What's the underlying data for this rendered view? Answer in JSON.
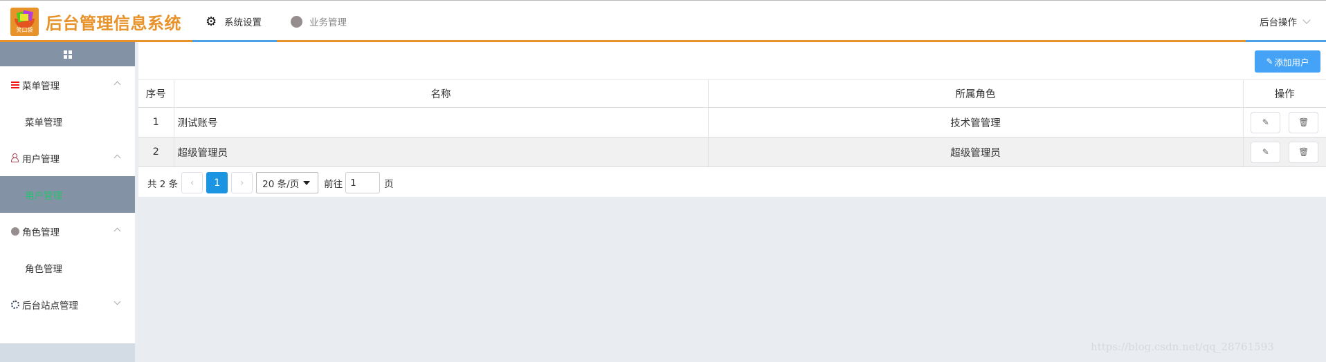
{
  "header": {
    "logo_text": "笑口袋",
    "app_title": "后台管理信息系统",
    "tabs": [
      {
        "label": "系统设置",
        "icon": "gear-icon",
        "active": true
      },
      {
        "label": "业务管理",
        "icon": "circle-icon",
        "active": false
      }
    ],
    "ops_label": "后台操作"
  },
  "sidebar": {
    "groups": [
      {
        "label": "菜单管理",
        "icon": "menu-lines-icon",
        "expanded": true,
        "items": [
          {
            "label": "菜单管理",
            "active": false
          }
        ]
      },
      {
        "label": "用户管理",
        "icon": "user-icon",
        "expanded": true,
        "items": [
          {
            "label": "用户管理",
            "active": true
          }
        ]
      },
      {
        "label": "角色管理",
        "icon": "role-dot-icon",
        "expanded": true,
        "items": [
          {
            "label": "角色管理",
            "active": false
          }
        ]
      },
      {
        "label": "后台站点管理",
        "icon": "site-gear-icon",
        "expanded": false,
        "items": []
      }
    ]
  },
  "toolbar": {
    "add_user_label": "添加用户"
  },
  "table": {
    "columns": [
      "序号",
      "名称",
      "所属角色",
      "操作"
    ],
    "rows": [
      {
        "index": "1",
        "name": "测试账号",
        "role": "技术管管理"
      },
      {
        "index": "2",
        "name": "超级管理员",
        "role": "超级管理员"
      }
    ],
    "row_actions": [
      "edit-icon",
      "delete-icon"
    ]
  },
  "pagination": {
    "total_text": "共 2 条",
    "prev": "‹",
    "current_page": "1",
    "next": "›",
    "page_size": "20 条/页",
    "goto_label": "前往",
    "goto_value": "1",
    "page_unit": "页"
  },
  "watermark": "https://blog.csdn.net/qq_28761593",
  "colors": {
    "brand": "#e8922a",
    "primary": "#44a3f7",
    "active_page": "#1b94e2",
    "sidebar_active_bg": "#8492a6",
    "sidebar_active_text": "#28c070"
  }
}
